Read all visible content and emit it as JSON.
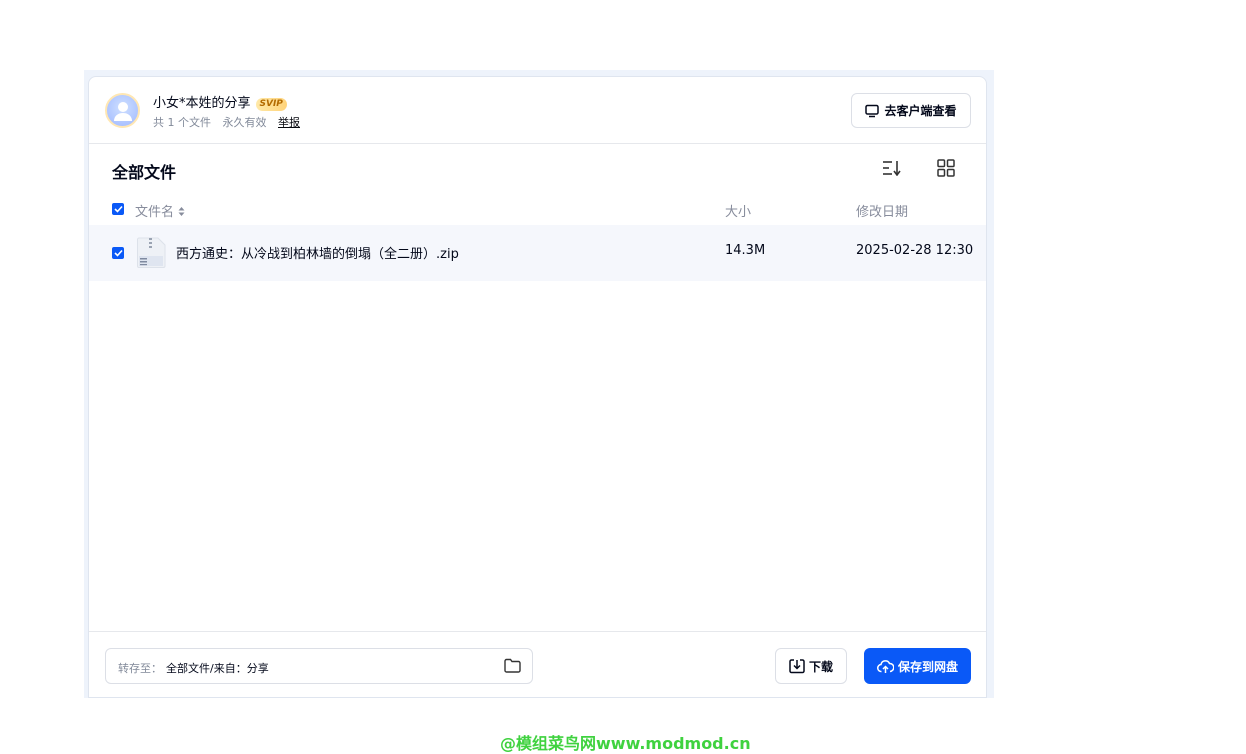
{
  "share": {
    "owner_title": "小女*本姓的分享",
    "vip_badge": "SVIP",
    "file_count": "共 1 个文件",
    "validity": "永久有效",
    "report_link": "举报",
    "client_button": "去客户端查看"
  },
  "list": {
    "section_title": "全部文件",
    "columns": {
      "name": "文件名",
      "size": "大小",
      "date": "修改日期"
    },
    "rows": [
      {
        "name": "西方通史：从冷战到柏林墙的倒塌（全二册）.zip",
        "size": "14.3M",
        "date": "2025-02-28 12:30",
        "checked": true
      }
    ]
  },
  "footer": {
    "save_to_label": "转存至：",
    "save_to_path": "全部文件/来自：分享",
    "download_button": "下载",
    "save_button": "保存到网盘"
  },
  "watermark": "@模组菜鸟网www.modmod.cn",
  "colors": {
    "accent": "#0a59f7",
    "watermark": "#3fd23f",
    "row_highlight": "#f5f7fc"
  },
  "icons": [
    "avatar-person-icon",
    "monitor-icon",
    "sort-icon",
    "grid-view-icon",
    "sort-arrows-icon",
    "zip-file-icon",
    "folder-icon",
    "download-icon",
    "cloud-upload-icon",
    "check-icon"
  ]
}
